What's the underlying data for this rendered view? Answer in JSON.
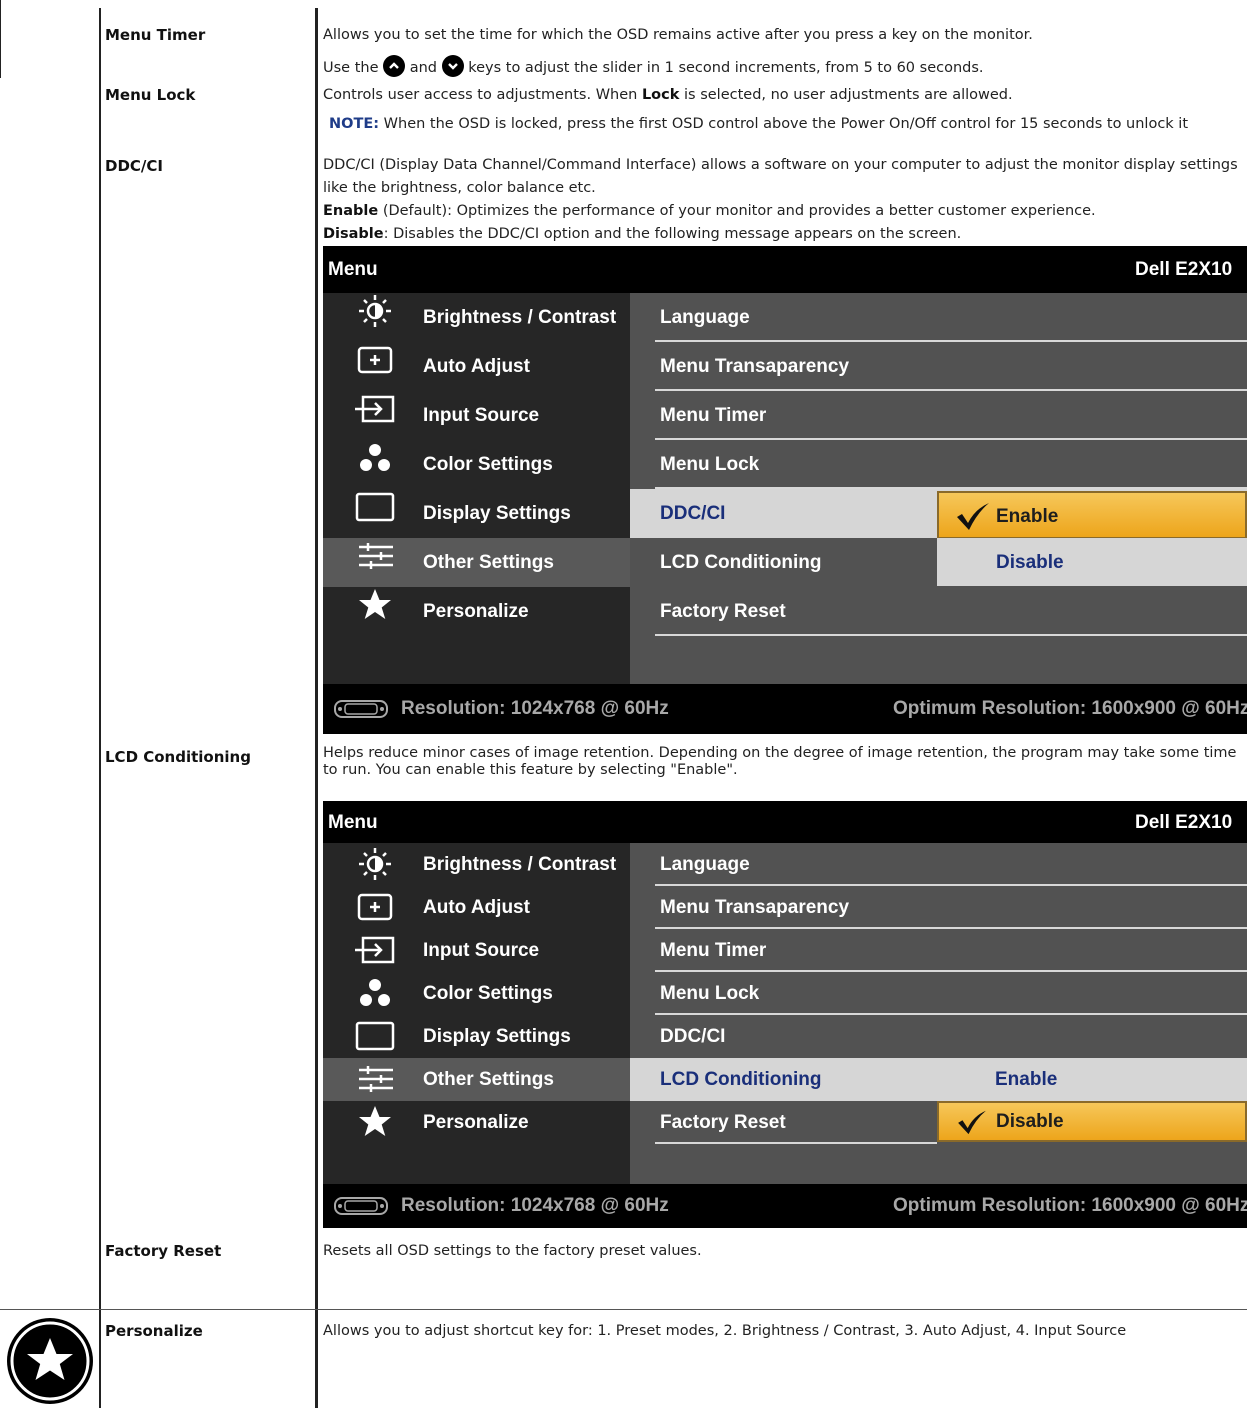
{
  "rows": {
    "menu_timer": {
      "label": "Menu Timer",
      "line1": "Allows you to set the time for which the OSD remains active after you press a key on the monitor.",
      "line2_pre": "Use the",
      "line2_mid": "and",
      "line2_post": "keys to adjust the slider in 1 second increments, from 5 to 60 seconds."
    },
    "menu_lock": {
      "label": "Menu Lock",
      "line1_pre": "Controls user access to adjustments. When",
      "line1_bold": "Lock",
      "line1_post": "is selected, no user adjustments are allowed.",
      "note_label": "NOTE:",
      "note_text": "When the OSD is locked, press the first OSD control above the Power On/Off control for 15 seconds to unlock it"
    },
    "ddc_ci": {
      "label": "DDC/CI",
      "intro": "DDC/CI (Display Data Channel/Command Interface) allows a software on your computer to adjust the monitor display settings like the brightness, color balance etc.",
      "enable_bold": "Enable",
      "enable_text": "(Default): Optimizes the performance of your monitor and provides a better customer experience.",
      "disable_bold": "Disable",
      "disable_text": ": Disables the DDC/CI option and the following message appears on the screen."
    },
    "lcd_conditioning": {
      "label": "LCD Conditioning",
      "text": "Helps reduce minor cases of image retention. Depending on the degree of image retention, the program may take some time to run. You can enable this feature by selecting \"Enable\"."
    },
    "factory_reset": {
      "label": "Factory Reset",
      "text": "Resets all OSD settings to the factory preset values."
    },
    "personalize": {
      "label": "Personalize",
      "text": "Allows you to adjust shortcut key for: 1. Preset modes, 2. Brightness / Contrast, 3. Auto Adjust, 4. Input Source"
    }
  },
  "osd": {
    "menu_title": "Menu",
    "model": "Dell E2X10",
    "left_items": [
      {
        "label": "Brightness / Contrast",
        "icon": "brightness-icon"
      },
      {
        "label": "Auto Adjust",
        "icon": "auto-adjust-icon"
      },
      {
        "label": "Input Source",
        "icon": "input-source-icon"
      },
      {
        "label": "Color Settings",
        "icon": "color-settings-icon"
      },
      {
        "label": "Display Settings",
        "icon": "display-settings-icon"
      },
      {
        "label": "Other Settings",
        "icon": "other-settings-icon"
      },
      {
        "label": "Personalize",
        "icon": "star-icon"
      }
    ],
    "right_items": [
      "Language",
      "Menu Transaparency",
      "Menu Timer",
      "Menu Lock",
      "DDC/CI",
      "LCD Conditioning",
      "Factory Reset"
    ],
    "enable": "Enable",
    "disable": "Disable",
    "resolution": "Resolution: 1024x768 @ 60Hz",
    "optimum": "Optimum Resolution: 1600x900 @ 60Hz"
  },
  "colors": {
    "osd_black": "#000000",
    "osd_left_bg": "#262626",
    "osd_right_bg": "#525252",
    "highlight_gray": "#d6d6d6",
    "highlight_gold": "#eda51b",
    "note_blue": "#1f3c88"
  }
}
